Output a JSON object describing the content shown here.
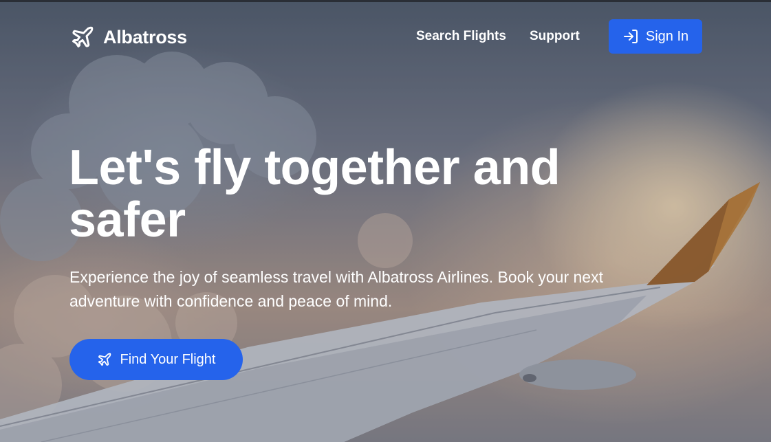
{
  "brand": {
    "name": "Albatross",
    "icon": "airplane-icon"
  },
  "nav": {
    "links": [
      {
        "label": "Search Flights"
      },
      {
        "label": "Support"
      }
    ],
    "signin": {
      "label": "Sign In",
      "icon": "sign-in-arrow-icon"
    }
  },
  "hero": {
    "title": "Let's fly together and safer",
    "subtitle": "Experience the joy of seamless travel with Albatross Airlines. Book your next adventure with confidence and peace of mind.",
    "cta": {
      "label": "Find Your Flight",
      "icon": "airplane-icon"
    }
  },
  "colors": {
    "accent": "#2563eb",
    "text": "#ffffff"
  }
}
